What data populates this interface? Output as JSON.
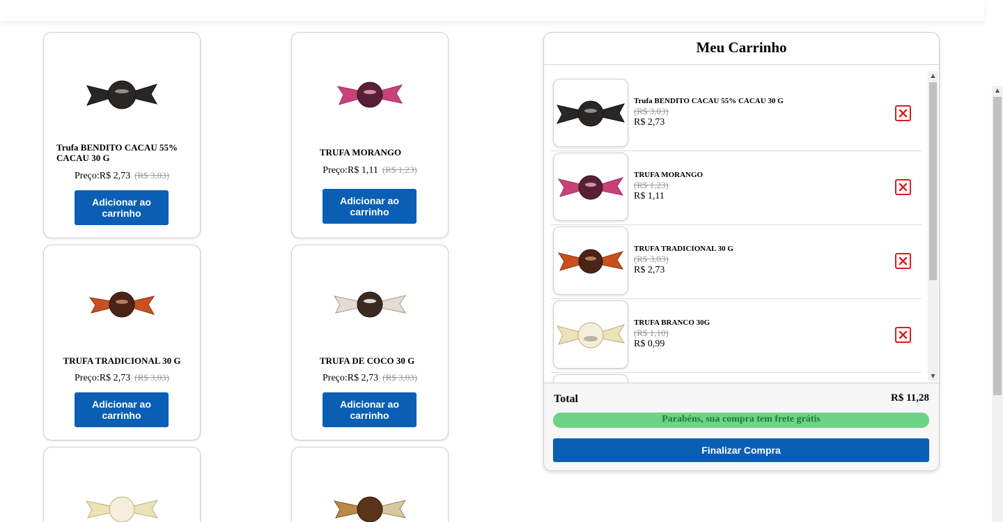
{
  "products": [
    {
      "name": "Trufa BENDITO CACAU 55% CACAU 30 G",
      "price_prefix": "Preço:",
      "price": "R$ 2,73",
      "old_price": "(R$ 3,03)",
      "button": "Adicionar ao carrinho",
      "wrapper_color": "#2a2624",
      "icon": "truffle-dark-icon"
    },
    {
      "name": "TRUFA MORANGO",
      "price_prefix": "Preço:",
      "price": "R$ 1,11",
      "old_price": "(R$ 1,23)",
      "button": "Adicionar ao carrinho",
      "wrapper_color": "#c9417a",
      "icon": "truffle-strawberry-icon"
    },
    {
      "name": "TRUFA TRADICIONAL 30 G",
      "price_prefix": "Preço:",
      "price": "R$ 2,73",
      "old_price": "(R$ 3,03)",
      "button": "Adicionar ao carrinho",
      "wrapper_color": "#c9501f",
      "icon": "truffle-traditional-icon"
    },
    {
      "name": "TRUFA DE COCO 30 G",
      "price_prefix": "Preço:",
      "price": "R$ 2,73",
      "old_price": "(R$ 3,03)",
      "button": "Adicionar ao carrinho",
      "wrapper_color": "#d8cfc4",
      "icon": "truffle-coconut-icon"
    },
    {
      "wrapper_color": "#ece3b8",
      "icon": "truffle-white-icon"
    },
    {
      "wrapper_color": "#8a5a2b",
      "icon": "truffle-caramel-icon"
    }
  ],
  "cart": {
    "title": "Meu Carrinho",
    "items": [
      {
        "name": "Trufa BENDITO CACAU 55% CACAU 30 G",
        "old_price": "(R$ 3,03)",
        "price": "R$ 2,73",
        "wrapper_color": "#2a2624"
      },
      {
        "name": "TRUFA MORANGO",
        "old_price": "(R$ 1,23)",
        "price": "R$ 1,11",
        "wrapper_color": "#c9417a"
      },
      {
        "name": "TRUFA TRADICIONAL 30 G",
        "old_price": "(R$ 3,03)",
        "price": "R$ 2,73",
        "wrapper_color": "#c9501f"
      },
      {
        "name": "TRUFA BRANCO 30G",
        "old_price": "(R$ 1,10)",
        "price": "R$ 0,99",
        "wrapper_color": "#ece3b8"
      }
    ],
    "total_label": "Total",
    "total_value": "R$ 11,28",
    "shipping_message": "Parabéns, sua compra tem frete grátis",
    "shipping_progress": 1.0,
    "checkout_button": "Finalizar Compra"
  },
  "colors": {
    "primary": "#0a5fb4",
    "remove": "#e0191b",
    "success_bar": "#6dd487",
    "success_text": "#237a2e"
  }
}
